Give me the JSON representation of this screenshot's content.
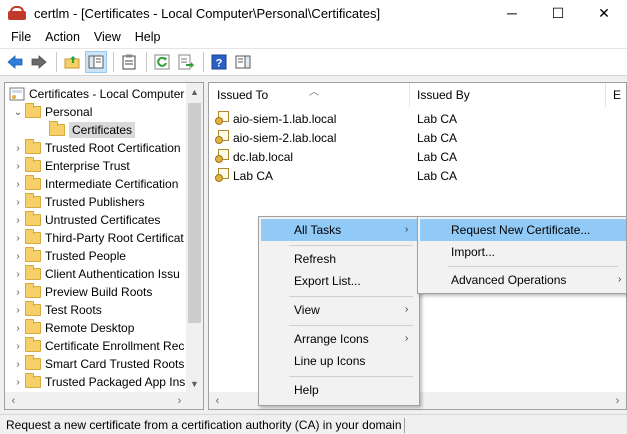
{
  "window": {
    "title": "certlm - [Certificates - Local Computer\\Personal\\Certificates]",
    "minimize": "─",
    "maximize": "☐",
    "close": "✕"
  },
  "menubar": [
    "File",
    "Action",
    "View",
    "Help"
  ],
  "tree": {
    "root": "Certificates - Local Computer",
    "personal": "Personal",
    "certificates": "Certificates",
    "items": [
      "Trusted Root Certification",
      "Enterprise Trust",
      "Intermediate Certification",
      "Trusted Publishers",
      "Untrusted Certificates",
      "Third-Party Root Certificat",
      "Trusted People",
      "Client Authentication Issu",
      "Preview Build Roots",
      "Test Roots",
      "Remote Desktop",
      "Certificate Enrollment Rec",
      "Smart Card Trusted Roots",
      "Trusted Packaged App Ins"
    ]
  },
  "list": {
    "columns": [
      "Issued To",
      "Issued By",
      "E"
    ],
    "rows": [
      {
        "issued_to": "aio-siem-1.lab.local",
        "issued_by": "Lab CA"
      },
      {
        "issued_to": "aio-siem-2.lab.local",
        "issued_by": "Lab CA"
      },
      {
        "issued_to": "dc.lab.local",
        "issued_by": "Lab CA"
      },
      {
        "issued_to": "Lab CA",
        "issued_by": "Lab CA"
      }
    ]
  },
  "context_menu": {
    "all_tasks": "All Tasks",
    "refresh": "Refresh",
    "export_list": "Export List...",
    "view": "View",
    "arrange_icons": "Arrange Icons",
    "line_up_icons": "Line up Icons",
    "help": "Help"
  },
  "submenu": {
    "request_new": "Request New Certificate...",
    "import": "Import...",
    "advanced": "Advanced Operations"
  },
  "status": "Request a new certificate from a certification authority (CA) in your domain",
  "colors": {
    "menu_highlight": "#91c9f7",
    "selection": "#d9d9d9",
    "folder": "#f4cf6a"
  }
}
